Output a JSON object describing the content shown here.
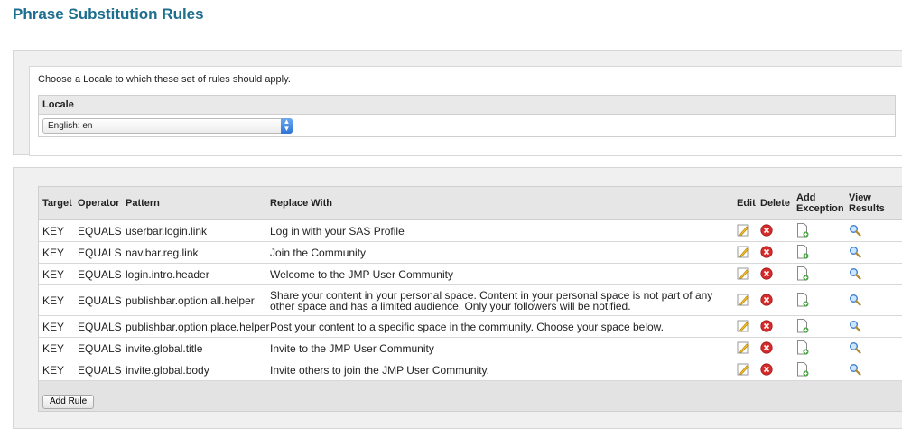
{
  "page": {
    "title": "Phrase Substitution Rules"
  },
  "locale": {
    "prompt": "Choose a Locale to which these set of rules should apply.",
    "header": "Locale",
    "selected": "English: en"
  },
  "table": {
    "headers": {
      "target": "Target",
      "operator": "Operator",
      "pattern": "Pattern",
      "replace": "Replace With",
      "edit": "Edit",
      "delete": "Delete",
      "add_exception": "Add Exception",
      "view_results": "View Results"
    },
    "rows": [
      {
        "target": "KEY",
        "operator": "EQUALS",
        "pattern": "userbar.login.link",
        "replace": "Log in with your SAS Profile"
      },
      {
        "target": "KEY",
        "operator": "EQUALS",
        "pattern": "nav.bar.reg.link",
        "replace": "Join the Community"
      },
      {
        "target": "KEY",
        "operator": "EQUALS",
        "pattern": "login.intro.header",
        "replace": "Welcome to the JMP User Community"
      },
      {
        "target": "KEY",
        "operator": "EQUALS",
        "pattern": "publishbar.option.all.helper",
        "replace": "Share your content in your personal space. Content in your personal space is not part of any other space and has a limited audience. Only your followers will be notified."
      },
      {
        "target": "KEY",
        "operator": "EQUALS",
        "pattern": "publishbar.option.place.helper",
        "replace": "Post your content to a specific space in the community. Choose your space below."
      },
      {
        "target": "KEY",
        "operator": "EQUALS",
        "pattern": "invite.global.title",
        "replace": "Invite to the JMP User Community"
      },
      {
        "target": "KEY",
        "operator": "EQUALS",
        "pattern": "invite.global.body",
        "replace": "Invite others to join the JMP User Community."
      }
    ],
    "icons": {
      "edit": "pencil-icon",
      "delete": "delete-x-icon",
      "add_exception": "add-document-icon",
      "view_results": "magnifier-icon"
    },
    "add_rule_label": "Add Rule"
  },
  "colors": {
    "title": "#1d6e8f",
    "delete": "#d62b2b",
    "select_accent": "#2f74d6"
  }
}
